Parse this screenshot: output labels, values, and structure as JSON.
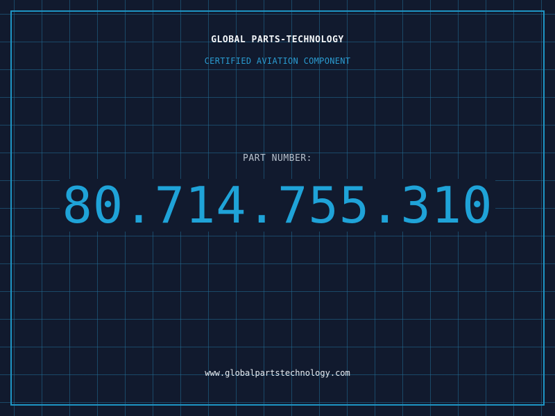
{
  "header": {
    "company": "GLOBAL PARTS-TECHNOLOGY",
    "subtitle": "CERTIFIED AVIATION COMPONENT"
  },
  "part": {
    "label": "PART NUMBER:",
    "number": "80.714.755.310"
  },
  "footer": {
    "url": "www.globalpartstechnology.com"
  },
  "colors": {
    "background": "#111a2e",
    "grid": "#226e96",
    "frame": "#1e95c4",
    "accent": "#1fa3d8",
    "title_text": "#f2f5f8",
    "label_text": "#b7c1cd"
  }
}
